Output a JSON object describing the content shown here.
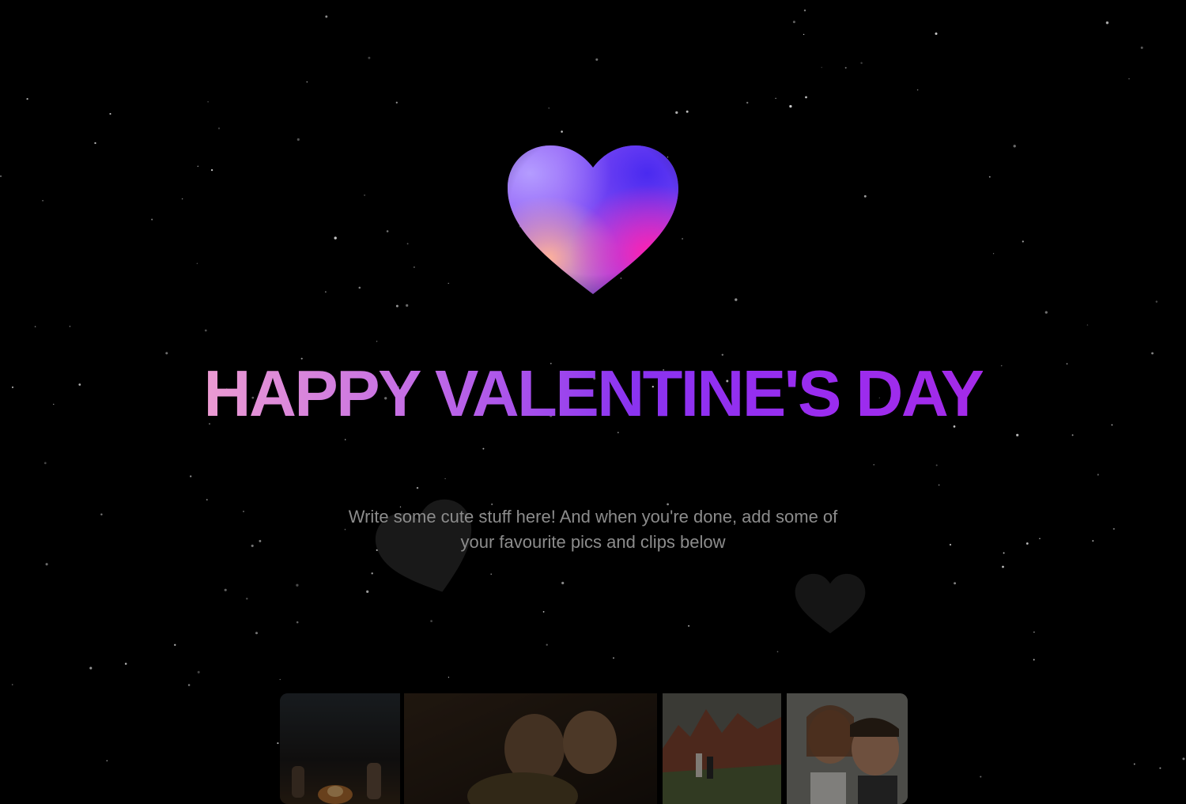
{
  "hero": {
    "title": "HAPPY VALENTINE'S DAY",
    "subtitle": "Write some cute stuff here! And when you're done, add some of your favourite pics and clips below",
    "heart_icon": "gradient-heart-icon"
  },
  "theme": {
    "background": "#000000",
    "title_gradient": [
      "#ec9bd2",
      "#c26be6",
      "#8a33f0",
      "#a42be8"
    ],
    "subtitle_color": "#8c8c8c",
    "heart_gradient": [
      "#a77cf8",
      "#5b3df2",
      "#ff3fb2",
      "#ffb0a0"
    ]
  },
  "gallery": {
    "photos": [
      {
        "name": "beach-bonfire-photo"
      },
      {
        "name": "couple-closeup-photo"
      },
      {
        "name": "red-rocks-photo"
      },
      {
        "name": "couple-smiling-photo"
      }
    ]
  }
}
